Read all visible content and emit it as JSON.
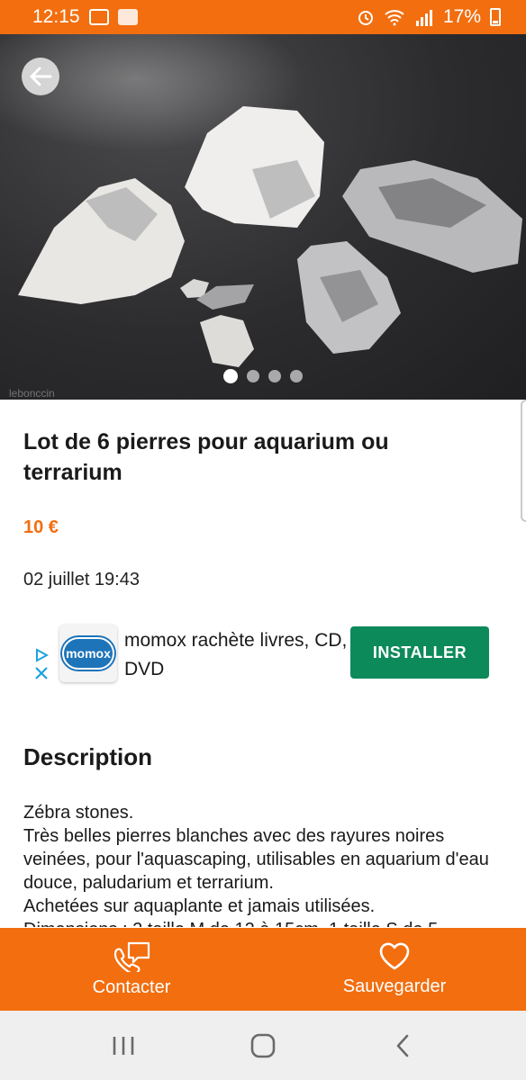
{
  "status_bar": {
    "time": "12:15",
    "battery": "17%",
    "left_icons": [
      "mail-icon",
      "photo-icon"
    ],
    "right_icons": [
      "alarm-icon",
      "wifi-icon",
      "signal-icon",
      "battery-icon"
    ]
  },
  "gallery": {
    "image_count": 4,
    "active_index": 0,
    "back_icon": "arrow-left-icon",
    "watermark": "lebonccin"
  },
  "listing": {
    "title": "Lot de 6 pierres pour aquarium ou terrarium",
    "price": "10 €",
    "date": "02 juillet 19:43"
  },
  "ad": {
    "text": "momox rachète livres, CD, DVD",
    "logo_text": "momox",
    "button_label": "INSTALLER",
    "button_color": "#0d8a5a",
    "choices_icons": [
      "ad-choices-icon",
      "close-icon"
    ]
  },
  "description": {
    "heading": "Description",
    "body": "Zébra stones.\nTrès belles pierres blanches avec des rayures noires veinées, pour l'aquascaping,  utilisables en aquarium d'eau douce, paludarium et terrarium.\nAchetées sur aquaplante et jamais utilisées.\nDimensions : 2 taille M de 12 à 15cm, 1 taille S de 5"
  },
  "actions": {
    "contact_label": "Contacter",
    "contact_icon": "phone-message-icon",
    "save_label": "Sauvegarder",
    "save_icon": "heart-icon"
  },
  "nav_bar": {
    "icons": [
      "recent-apps-icon",
      "home-icon",
      "back-icon"
    ]
  },
  "colors": {
    "brand_orange": "#f26e0f",
    "install_green": "#0d8a5a"
  }
}
